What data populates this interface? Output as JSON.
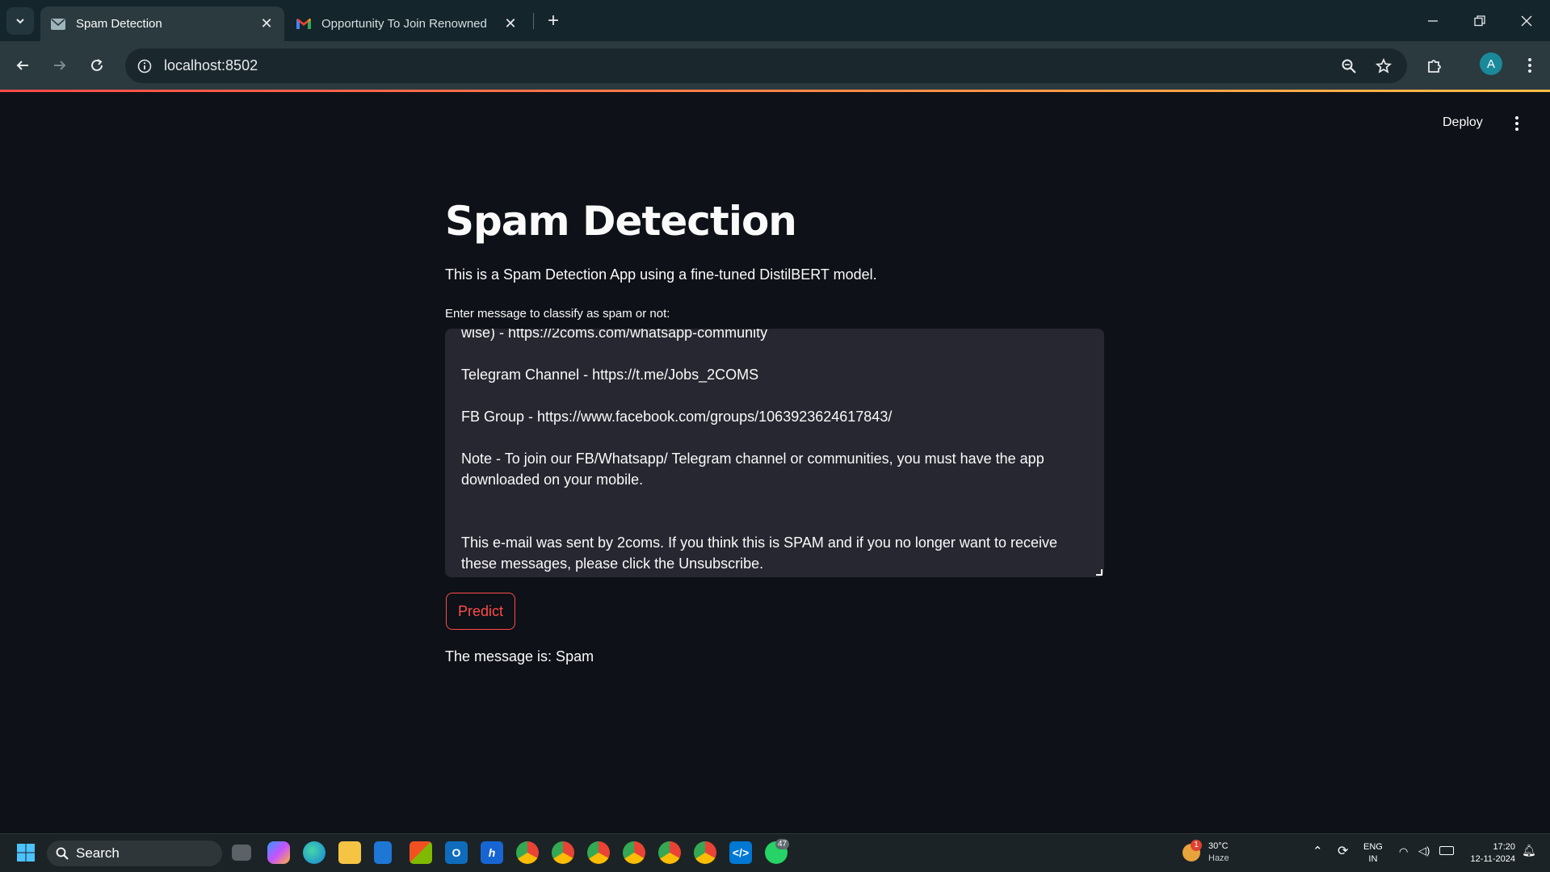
{
  "browser": {
    "tabs": [
      {
        "title": "Spam Detection",
        "active": true,
        "icon": "streamlit-favicon-icon"
      },
      {
        "title": "Opportunity To Join Renowned",
        "active": false,
        "icon": "gmail-icon"
      }
    ],
    "url": "localhost:8502",
    "profile_initial": "A"
  },
  "app": {
    "deploy_label": "Deploy",
    "title": "Spam Detection",
    "description": "This is a Spam Detection App using a fine-tuned DistilBERT model.",
    "input_label": "Enter message to classify as spam or not:",
    "message_text": "wise) - https://2coms.com/whatsapp-community\n\nTelegram Channel - https://t.me/Jobs_2COMS\n\nFB Group - https://www.facebook.com/groups/1063923624617843/\n\nNote - To join our FB/Whatsapp/ Telegram channel or communities, you must have the app downloaded on your mobile.\n\n\nThis e-mail was sent by 2coms. If you think this is SPAM and if you no longer want to receive these messages, please click the Unsubscribe.",
    "predict_label": "Predict",
    "result_text": "The message is: Spam",
    "accent_color": "#ff4b4b"
  },
  "taskbar": {
    "search_label": "Search",
    "weather_temp": "30°C",
    "weather_desc": "Haze",
    "weather_badge": "1",
    "lang_top": "ENG",
    "lang_bottom": "IN",
    "time": "17:20",
    "date": "12-11-2024",
    "whatsapp_badge": "47",
    "pinned_apps": [
      "task-view-icon",
      "copilot-icon",
      "edge-icon",
      "file-explorer-icon",
      "store-bag-icon",
      "microsoft-store-icon",
      "outlook-icon",
      "h-app-icon",
      "chrome-icon",
      "chrome-icon",
      "chrome-icon",
      "chrome-icon",
      "chrome-icon",
      "chrome-icon",
      "vscode-icon",
      "whatsapp-icon"
    ]
  }
}
